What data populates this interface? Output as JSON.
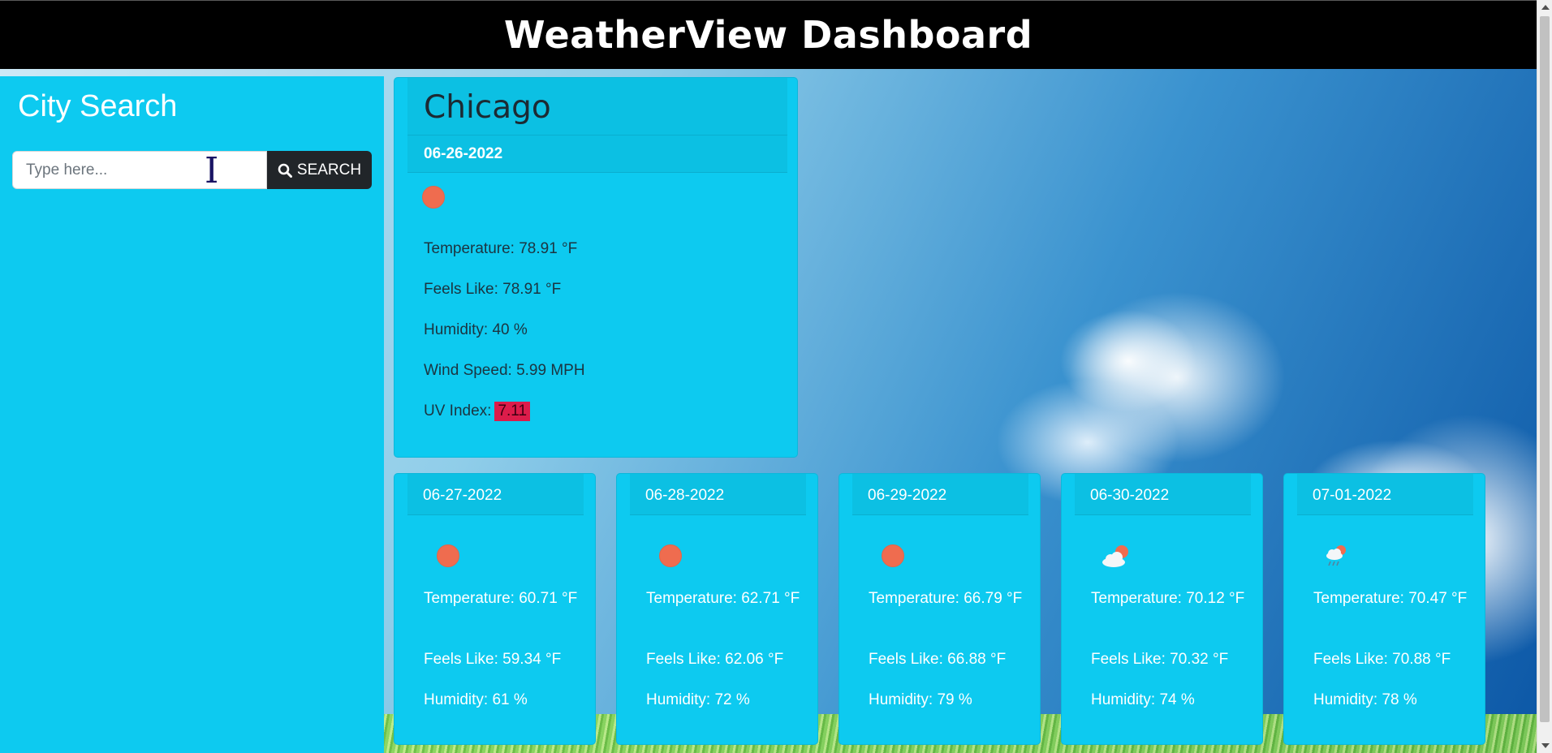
{
  "header": {
    "title": "WeatherView Dashboard"
  },
  "sidebar": {
    "title": "City Search",
    "search_placeholder": "Type here...",
    "search_value": "",
    "search_button_label": "SEARCH",
    "search_icon": "search-icon"
  },
  "current": {
    "city": "Chicago",
    "date": "06-26-2022",
    "icon": "sun-icon",
    "temperature": "Temperature: 78.91 °F",
    "feels_like": "Feels Like: 78.91 °F",
    "humidity": "Humidity: 40 %",
    "wind_speed": "Wind Speed: 5.99 MPH",
    "uv_label": "UV Index:",
    "uv_value": "7.11",
    "uv_color": "#dc1c4a"
  },
  "forecast": [
    {
      "date": "06-27-2022",
      "icon": "sun-icon",
      "temperature": "Temperature: 60.71 °F",
      "feels_like": "Feels Like: 59.34 °F",
      "humidity": "Humidity: 61 %"
    },
    {
      "date": "06-28-2022",
      "icon": "sun-icon",
      "temperature": "Temperature: 62.71 °F",
      "feels_like": "Feels Like: 62.06 °F",
      "humidity": "Humidity: 72 %"
    },
    {
      "date": "06-29-2022",
      "icon": "sun-icon",
      "temperature": "Temperature: 66.79 °F",
      "feels_like": "Feels Like: 66.88 °F",
      "humidity": "Humidity: 79 %"
    },
    {
      "date": "06-30-2022",
      "icon": "cloud-sun-icon",
      "temperature": "Temperature: 70.12 °F",
      "feels_like": "Feels Like: 70.32 °F",
      "humidity": "Humidity: 74 %"
    },
    {
      "date": "07-01-2022",
      "icon": "rain-sun-icon",
      "temperature": "Temperature: 70.47 °F",
      "feels_like": "Feels Like: 70.88 °F",
      "humidity": "Humidity: 78 %"
    }
  ],
  "colors": {
    "card": "#0dcaf0",
    "header_bg": "#000000",
    "button_bg": "#212529",
    "sun": "#ef6c4f"
  }
}
